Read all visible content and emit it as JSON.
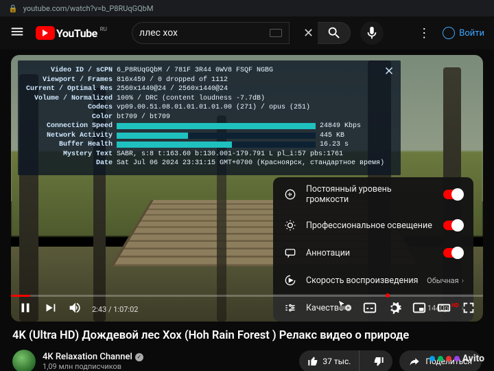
{
  "browser": {
    "url": "youtube.com/watch?v=b_P8RUqGQbM"
  },
  "masthead": {
    "country": "RU",
    "brand": "YouTube",
    "search_value": "ллес хох",
    "signin": "Войти"
  },
  "nerd": {
    "rows": [
      {
        "k": "Video ID / sCPN",
        "v": "6_P8RUqGQbM / 781F 3R44 0WV8 FSQF NGBG"
      },
      {
        "k": "Viewport / Frames",
        "v": "816x459 / 0 dropped of 1112"
      },
      {
        "k": "Current / Optimal Res",
        "v": "2560x1440@24 / 2560x1440@24"
      },
      {
        "k": "Volume / Normalized",
        "v": "100% / DRC (content loudness -7.7dB)"
      },
      {
        "k": "Codecs",
        "v": "vp09.00.51.08.01.01.01.01.00 (271) / opus (251)"
      },
      {
        "k": "Color",
        "v": "bt709 / bt709"
      }
    ],
    "bars": [
      {
        "k": "Connection Speed",
        "pct": 100,
        "v": "24849 Kbps"
      },
      {
        "k": "Network Activity",
        "pct": 36,
        "v": "445 KB"
      },
      {
        "k": "Buffer Health",
        "pct": 58,
        "v": "16.23 s"
      }
    ],
    "tail": [
      {
        "k": "Mystery Text",
        "v": "SABR, s:8 t:163.60 b:130.001-179.791 L pl_i:57 pbs:1761"
      },
      {
        "k": "Date",
        "v": "Sat Jul 06 2024 23:31:15 GMT+0700 (Красноярск, стандартное время)"
      }
    ]
  },
  "settings": {
    "stable_volume": "Постоянный уровень громкости",
    "lighting": "Профессиональное освещение",
    "annotations": "Аннотации",
    "speed_label": "Скорость воспроизведения",
    "speed_value": "Обычная",
    "quality_label": "Качество",
    "quality_value": "1440p",
    "quality_badge": "HD"
  },
  "player": {
    "current": "2:43",
    "duration": "1:07:02"
  },
  "video": {
    "title": "4K (Ultra HD) Дождевой лес Хох (Hoh Rain Forest ) Релакс видео о природе",
    "channel": "4K Relaxation Channel",
    "subs": "1,09 млн подписчиков",
    "likes": "37 тыс.",
    "share": "Поделиться"
  },
  "watermark": "Avito"
}
